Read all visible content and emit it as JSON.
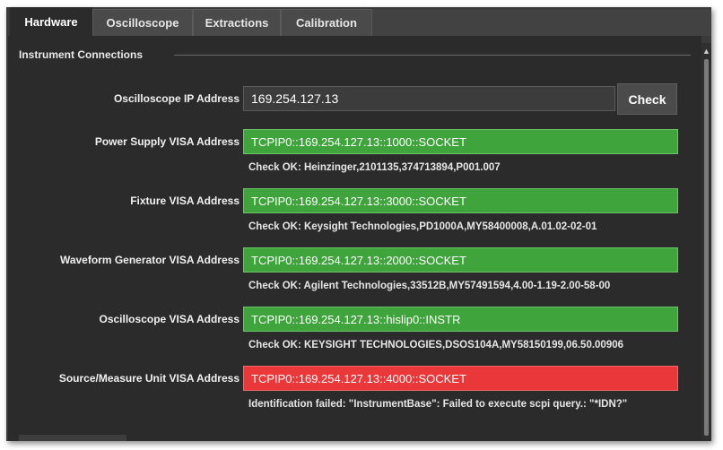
{
  "tabs": [
    {
      "label": "Hardware",
      "active": true
    },
    {
      "label": "Oscilloscope",
      "active": false
    },
    {
      "label": "Extractions",
      "active": false
    },
    {
      "label": "Calibration",
      "active": false
    }
  ],
  "section": {
    "title": "Instrument Connections"
  },
  "rows": [
    {
      "label": "Oscilloscope IP Address",
      "value": "169.254.127.13",
      "status": "",
      "state": "plain"
    },
    {
      "label": "Power Supply VISA Address",
      "value": "TCPIP0::169.254.127.13::1000::SOCKET",
      "status": "Check OK: Heinzinger,2101135,374713894,P001.007",
      "state": "ok"
    },
    {
      "label": "Fixture VISA Address",
      "value": "TCPIP0::169.254.127.13::3000::SOCKET",
      "status": "Check OK: Keysight Technologies,PD1000A,MY58400008,A.01.02-02-01",
      "state": "ok"
    },
    {
      "label": "Waveform Generator VISA Address",
      "value": "TCPIP0::169.254.127.13::2000::SOCKET",
      "status": "Check OK: Agilent Technologies,33512B,MY57491594,4.00-1.19-2.00-58-00",
      "state": "ok"
    },
    {
      "label": "Oscilloscope VISA Address",
      "value": "TCPIP0::169.254.127.13::hislip0::INSTR",
      "status": "Check OK: KEYSIGHT TECHNOLOGIES,DSOS104A,MY58150199,06.50.00906",
      "state": "ok"
    },
    {
      "label": "Source/Measure Unit VISA Address",
      "value": "TCPIP0::169.254.127.13::4000::SOCKET",
      "status": "Identification failed: \"InstrumentBase\": Failed to execute scpi query.: \"*IDN?\"",
      "state": "fail"
    }
  ],
  "check_button": {
    "label": "Check"
  },
  "colors": {
    "ok": "#3fa43c",
    "fail": "#e9373a",
    "background": "#2b2b2b"
  },
  "icons": {
    "scroll_up": "chevron-up-icon"
  }
}
